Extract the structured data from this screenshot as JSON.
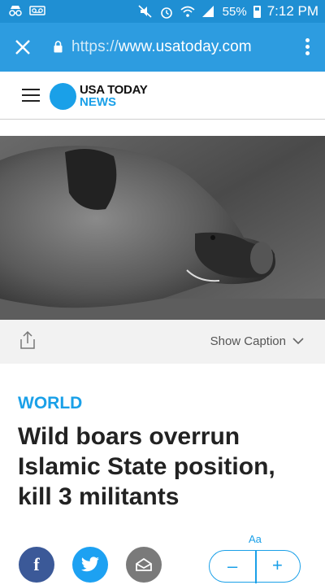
{
  "status_bar": {
    "battery": "55%",
    "time": "7:12 PM",
    "icons": [
      "incognito-icon",
      "voicemail-icon",
      "mute-vibrate-icon",
      "alarm-icon",
      "wifi-icon",
      "signal-icon",
      "battery-icon"
    ]
  },
  "browser": {
    "url_protocol": "https://",
    "url_host": "www.usatoday.com",
    "close_icon": "close-icon",
    "menu_icon": "more-vert-icon"
  },
  "site": {
    "logo_line1": "USA TODAY",
    "logo_line2": "NEWS",
    "menu_icon": "hamburger-icon"
  },
  "caption_bar": {
    "show_caption_label": "Show Caption",
    "share_icon": "share-icon"
  },
  "article": {
    "section": "WORLD",
    "headline": "Wild boars overrun Islamic State position, kill 3 militants"
  },
  "bottom_bar": {
    "facebook_label": "f",
    "font_size_label": "Aa",
    "font_decrease": "–",
    "font_increase": "+"
  },
  "colors": {
    "browser_bar": "#2d9ce0",
    "brand_blue": "#1aa0e8",
    "headline": "#222222",
    "facebook": "#3b5998",
    "twitter": "#1da1f2"
  }
}
